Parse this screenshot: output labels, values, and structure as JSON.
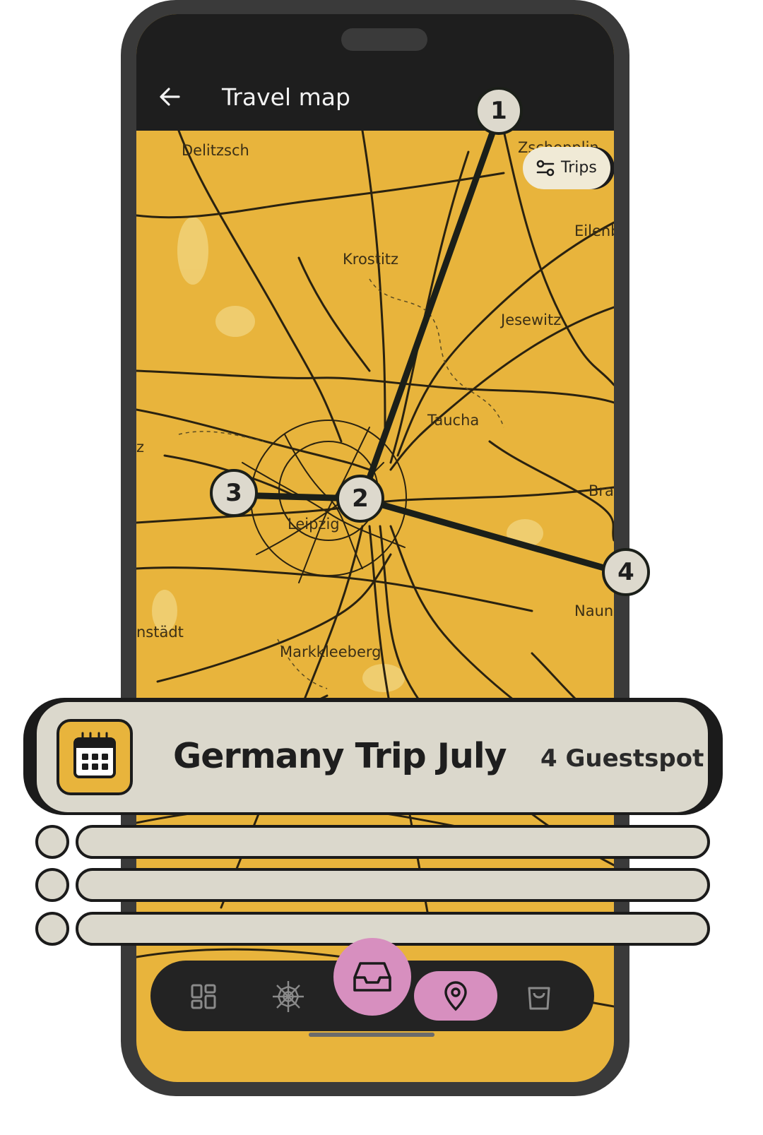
{
  "appbar": {
    "title": "Travel map"
  },
  "map": {
    "places": [
      "Delitzsch",
      "Zschepplin",
      "Eilenb",
      "Krostitz",
      "Jesewitz",
      "Taucha",
      "Leipzig",
      "Bra",
      "Naun",
      "nstädt",
      "Markkleeberg",
      "z"
    ],
    "filter_button": {
      "label": "Trips",
      "icon": "sliders-icon"
    },
    "markers": [
      "1",
      "2",
      "3",
      "4"
    ]
  },
  "trip_card": {
    "icon": "calendar-icon",
    "title": "Germany Trip July",
    "subtitle": "4 Guestspot"
  },
  "bottom_nav": {
    "items": [
      "dashboard-icon",
      "web-icon",
      "inbox-icon",
      "location-pin-icon",
      "shopping-bag-icon"
    ],
    "active": "location-pin-icon",
    "accent": "#d78fbf"
  },
  "colors": {
    "map": "#e8b43c",
    "appbar": "#1e1e1e",
    "card": "#dbd8cc",
    "route": "#1b1f19"
  }
}
